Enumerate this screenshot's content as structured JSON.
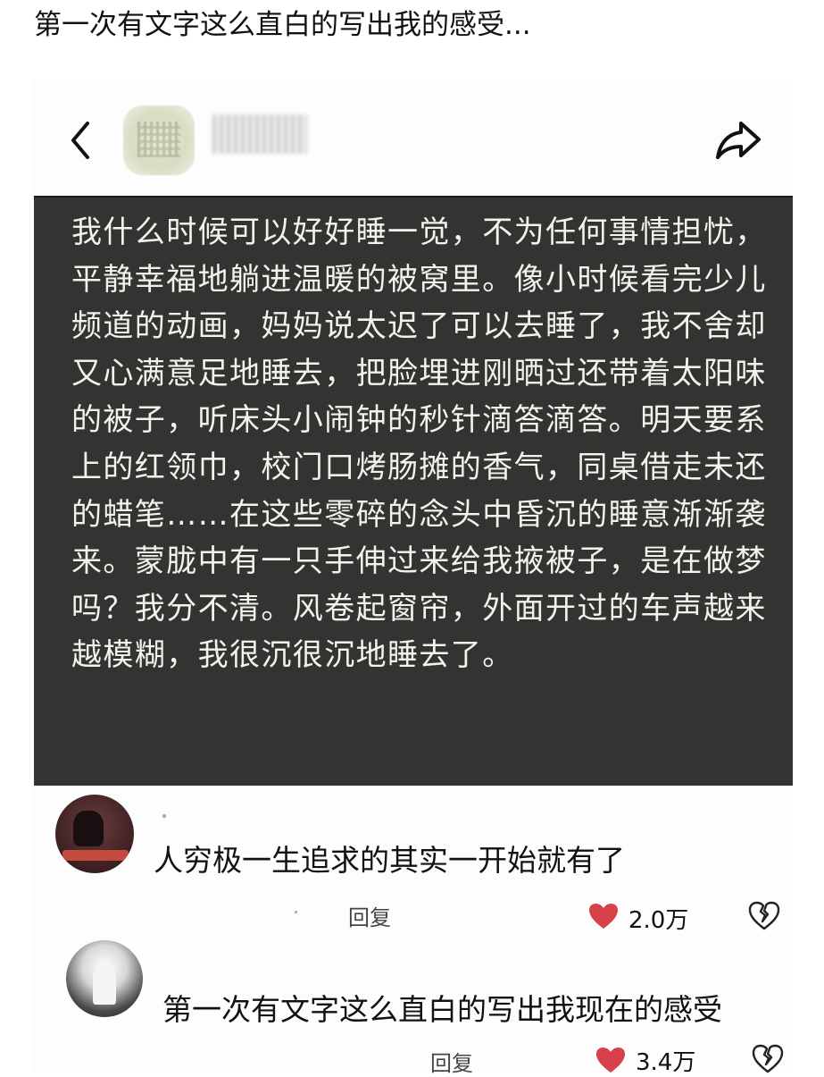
{
  "title": "第一次有文字这么直白的写出我的感受...",
  "header": {
    "back_icon": "chevron-left-icon",
    "share_icon": "share-icon"
  },
  "post": {
    "text": "我什么时候可以好好睡一觉，不为任何事情担忧，平静幸福地躺进温暖的被窝里。像小时候看完少儿频道的动画，妈妈说太迟了可以去睡了，我不舍却又心满意足地睡去，把脸埋进刚晒过还带着太阳味的被子，听床头小闹钟的秒针滴答滴答。明天要系上的红领巾，校门口烤肠摊的香气，同桌借走未还的蜡笔……在这些零碎的念头中昏沉的睡意渐渐袭来。蒙胧中有一只手伸过来给我掖被子，是在做梦吗？我分不清。风卷起窗帘，外面开过的车声越来越模糊，我很沉很沉地睡去了。"
  },
  "comments": [
    {
      "text": "人穷极一生追求的其实一开始就有了",
      "reply_label": "回复",
      "likes": "2.0万"
    },
    {
      "text": "第一次有文字这么直白的写出我现在的感受",
      "reply_label": "回复",
      "likes": "3.4万"
    }
  ],
  "colors": {
    "post_background": "#313431",
    "post_text": "#f3f3ee",
    "like_heart": "#d8404a"
  }
}
